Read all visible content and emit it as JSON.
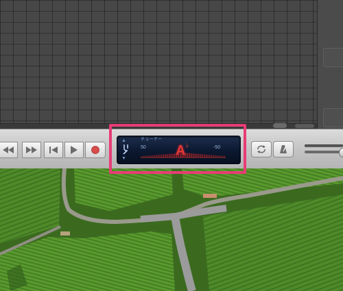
{
  "tuner": {
    "label": "チューナー",
    "scale_left": "50",
    "scale_right": "-50",
    "note": "A",
    "accidental": "♭",
    "mode_up": "▲",
    "mode_down": "▼"
  },
  "transport": {
    "buttons": [
      "rewind",
      "fast-forward",
      "go-to-beginning",
      "play",
      "record"
    ]
  },
  "icons": {
    "tuner_icon": "tuning-fork-icon",
    "cycle_icon": "cycle-icon",
    "metronome_icon": "metronome-icon"
  },
  "colors": {
    "highlight": "#e83c75",
    "tuner_note": "#e23838",
    "lcd_background": "#0c1830",
    "control_bar": "#c6c6c6",
    "record_dot": "#d94c4c"
  }
}
